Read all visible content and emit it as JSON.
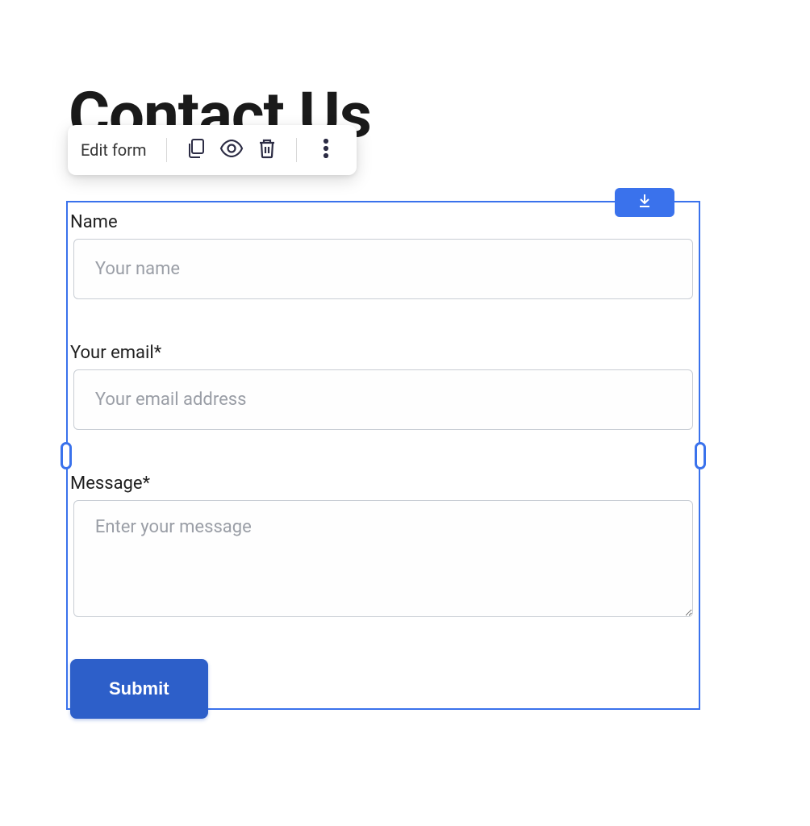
{
  "heading": "Contact Us",
  "toolbar": {
    "edit_label": "Edit form"
  },
  "fields": {
    "name": {
      "label": "Name",
      "placeholder": "Your name"
    },
    "email": {
      "label": "Your email*",
      "placeholder": "Your email address"
    },
    "message": {
      "label": "Message*",
      "placeholder": "Enter your message"
    }
  },
  "submit_label": "Submit"
}
